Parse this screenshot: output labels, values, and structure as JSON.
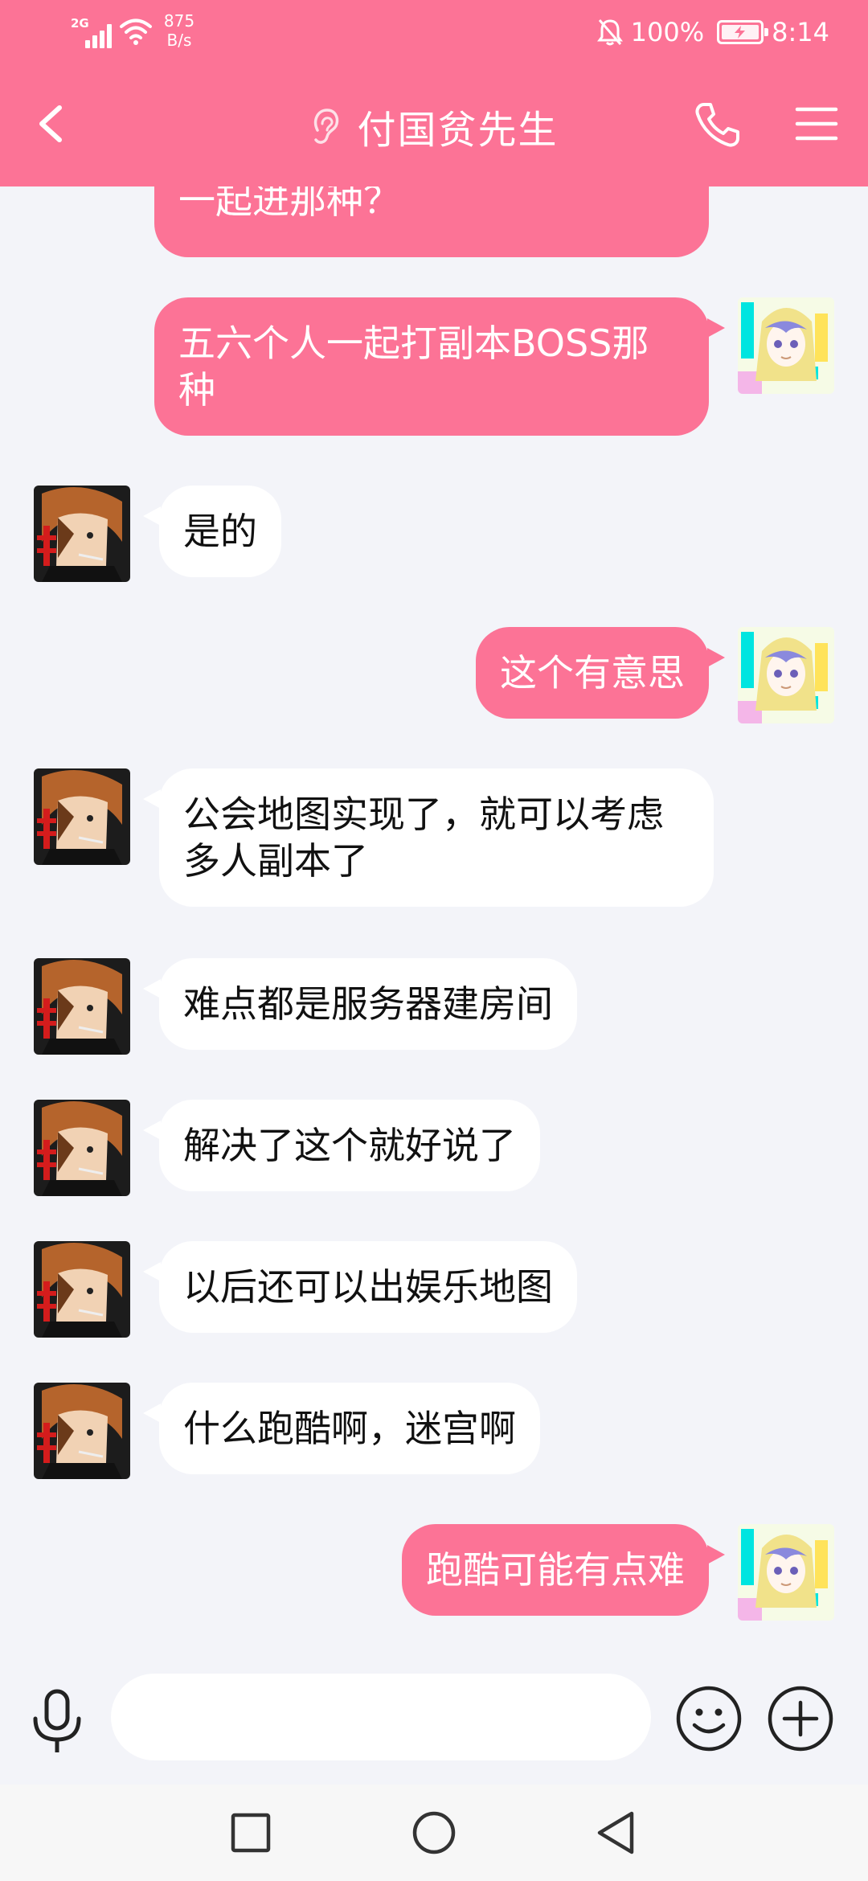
{
  "status_bar": {
    "network_tag": "2G",
    "speed_value": "875",
    "speed_unit": "B/s",
    "battery_percent": "100%",
    "time": "8:14"
  },
  "header": {
    "title": "付国贫先生",
    "icons": [
      "back-icon",
      "ear-icon",
      "phone-icon",
      "menu-icon"
    ]
  },
  "messages": [
    {
      "side": "right",
      "text": "一起进那种？"
    },
    {
      "side": "right",
      "text": "五六个人一起打副本BOSS那种"
    },
    {
      "side": "left",
      "text": "是的"
    },
    {
      "side": "right",
      "text": "这个有意思"
    },
    {
      "side": "left",
      "text": "公会地图实现了，就可以考虑多人副本了"
    },
    {
      "side": "left",
      "text": "难点都是服务器建房间"
    },
    {
      "side": "left",
      "text": "解决了这个就好说了"
    },
    {
      "side": "left",
      "text": "以后还可以出娱乐地图"
    },
    {
      "side": "left",
      "text": "什么跑酷啊，迷宫啊"
    },
    {
      "side": "right",
      "text": "跑酷可能有点难"
    }
  ],
  "input": {
    "value": "",
    "icons": [
      "mic-icon",
      "emoji-icon",
      "plus-icon"
    ]
  },
  "nav": {
    "icons": [
      "recents-icon",
      "home-icon",
      "back-nav-icon"
    ]
  },
  "colors": {
    "accent": "#fc7396",
    "background": "#f3f4f9",
    "bubble_left": "#ffffff"
  }
}
